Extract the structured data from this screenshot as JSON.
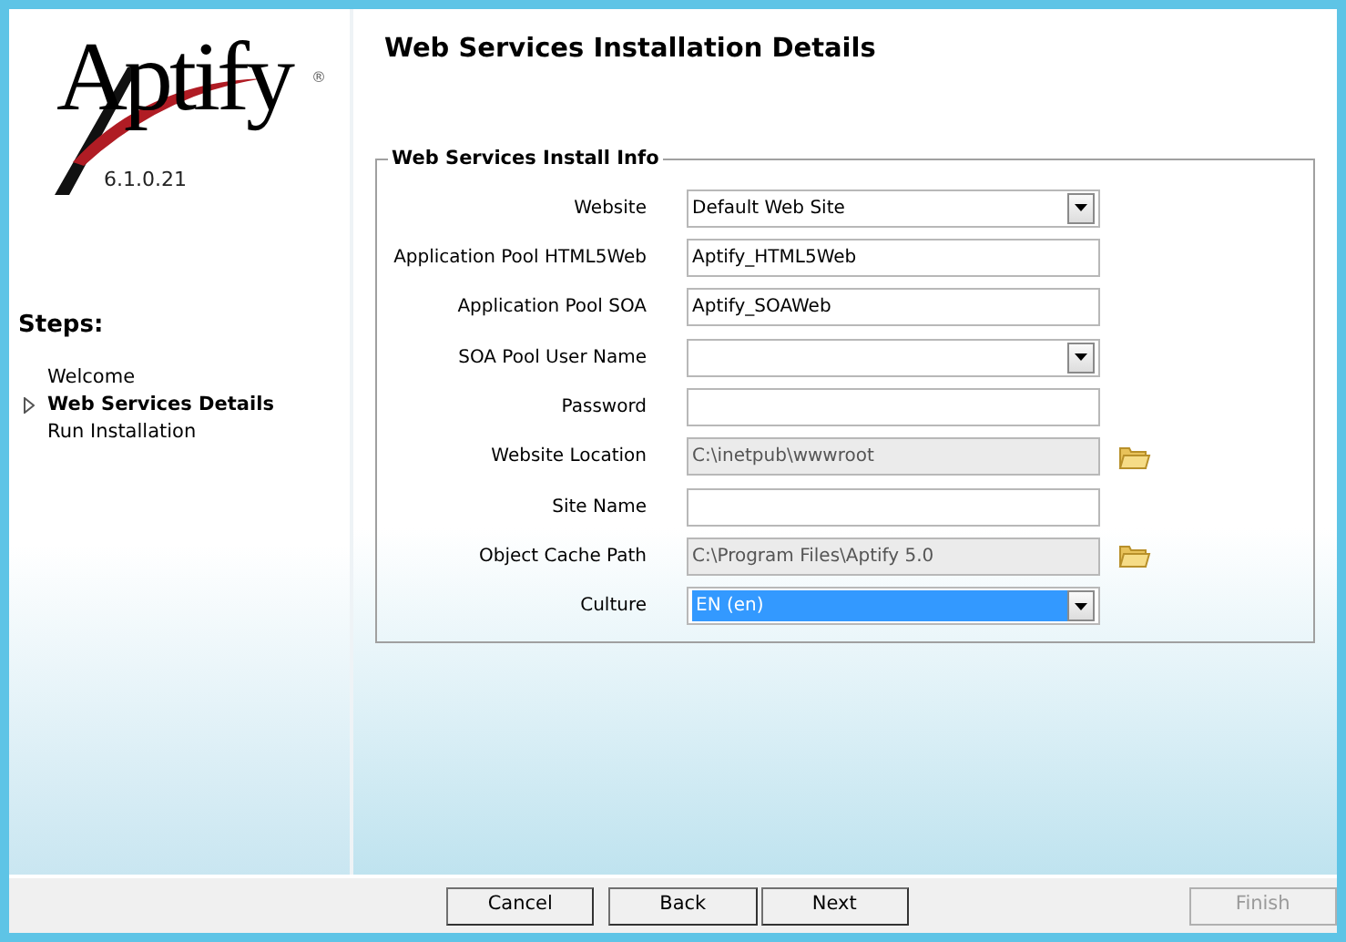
{
  "logo": {
    "name": "Aptify",
    "mark": "®",
    "version": "6.1.0.21"
  },
  "steps": {
    "title": "Steps:",
    "items": [
      {
        "label": "Welcome",
        "current": false
      },
      {
        "label": "Web Services Details",
        "current": true
      },
      {
        "label": "Run Installation",
        "current": false
      }
    ]
  },
  "page_title": "Web Services Installation Details",
  "group": {
    "title": "Web Services Install Info",
    "fields": [
      {
        "label": "Website",
        "kind": "dropdown",
        "value": "Default Web Site",
        "disabled": false,
        "selected": false
      },
      {
        "label": "Application Pool HTML5Web",
        "kind": "text",
        "value": "Aptify_HTML5Web",
        "disabled": false,
        "selected": false
      },
      {
        "label": "Application Pool SOA",
        "kind": "text",
        "value": "Aptify_SOAWeb",
        "disabled": false,
        "selected": false
      },
      {
        "label": "SOA Pool User Name",
        "kind": "dropdown",
        "disabled": false,
        "selected": false
      },
      {
        "label": "Password",
        "kind": "text",
        "disabled": false,
        "selected": false
      },
      {
        "label": "Website Location",
        "kind": "browse",
        "value": "C:\\inetpub\\wwwroot",
        "disabled": true,
        "selected": false
      },
      {
        "label": "Site Name",
        "kind": "text",
        "disabled": false,
        "selected": false
      },
      {
        "label": "Object Cache Path",
        "kind": "browse",
        "value": "C:\\Program Files\\Aptify 5.0",
        "disabled": true,
        "selected": false
      },
      {
        "label": "Culture",
        "kind": "dropdown",
        "value": "EN (en)",
        "disabled": false,
        "selected": true
      }
    ]
  },
  "buttons": [
    {
      "label": "Cancel",
      "disabled": false
    },
    {
      "label": "Back",
      "disabled": false
    },
    {
      "label": "Next",
      "disabled": false
    },
    {
      "label": "Finish",
      "disabled": true
    }
  ]
}
